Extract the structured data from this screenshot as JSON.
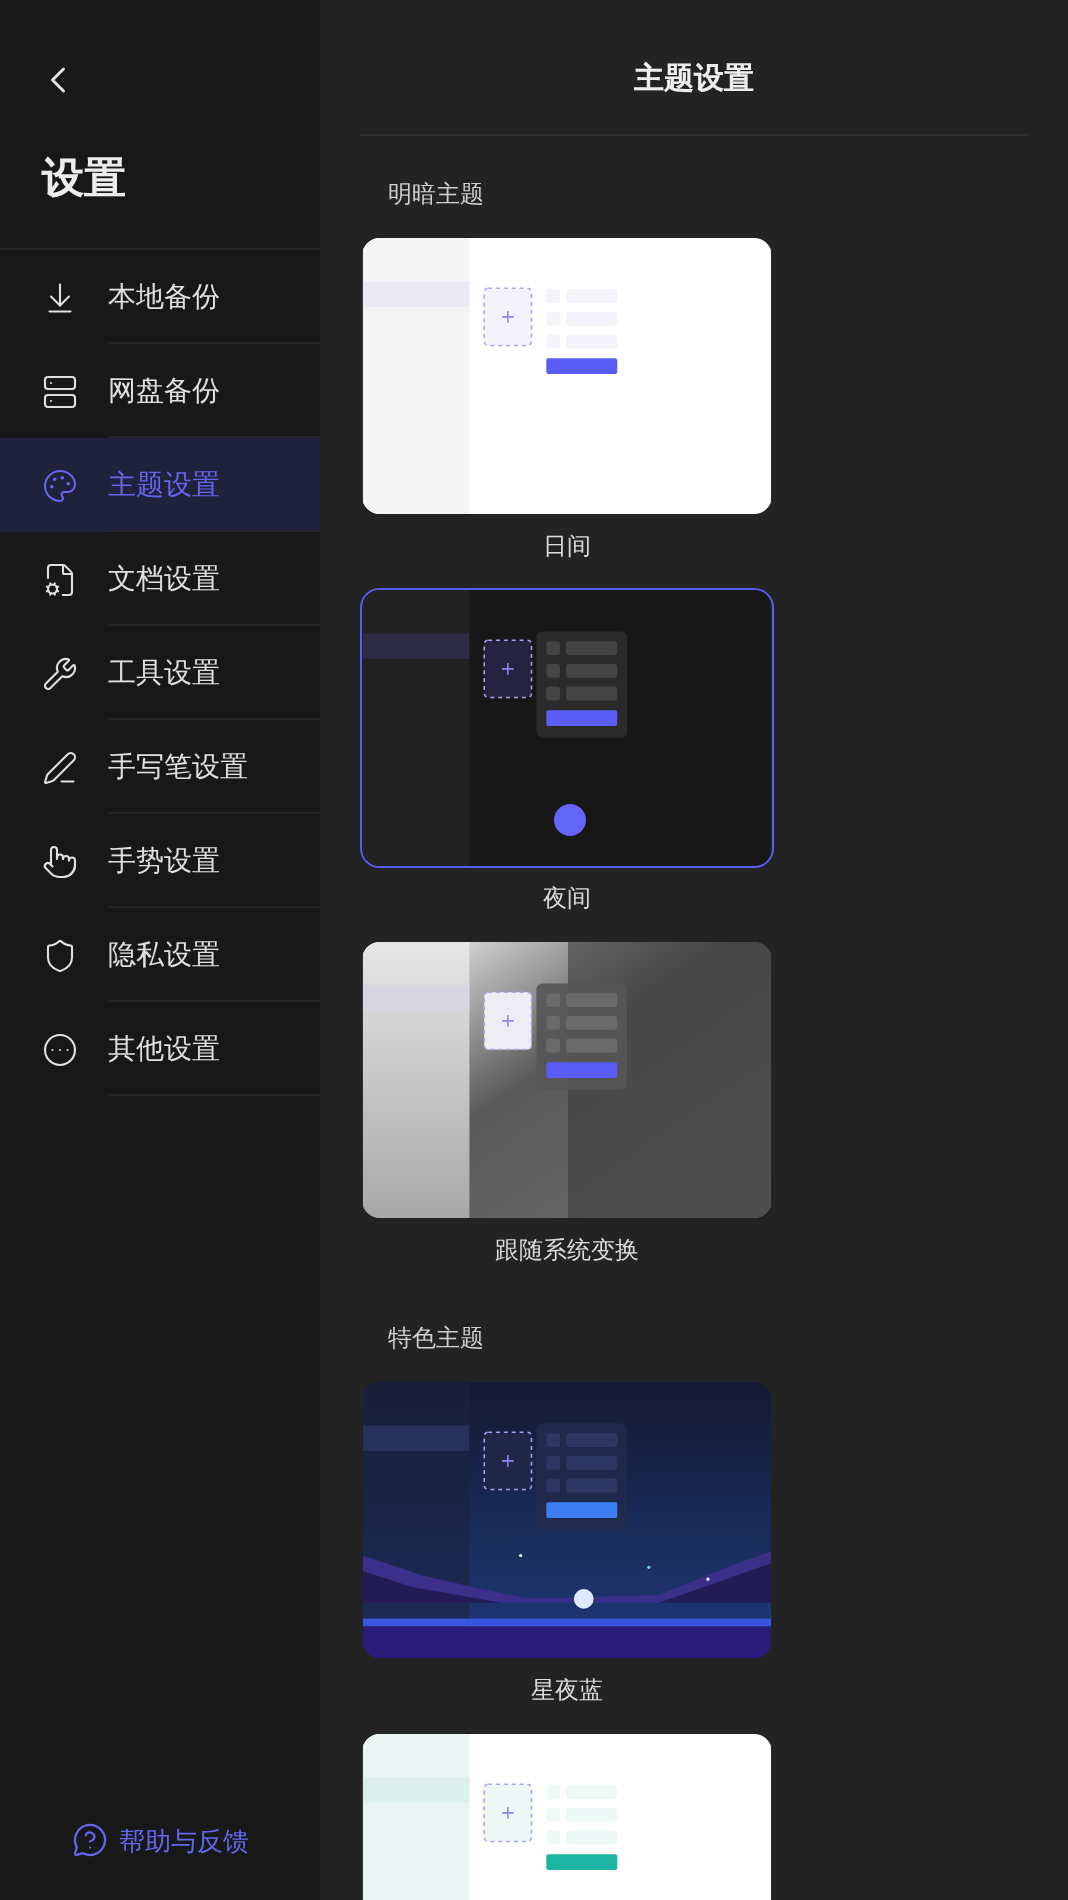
{
  "sidebar": {
    "title": "设置",
    "items": [
      {
        "label": "本地备份",
        "selected": false
      },
      {
        "label": "网盘备份",
        "selected": false
      },
      {
        "label": "主题设置",
        "selected": true
      },
      {
        "label": "文档设置",
        "selected": false
      },
      {
        "label": "工具设置",
        "selected": false
      },
      {
        "label": "手写笔设置",
        "selected": false
      },
      {
        "label": "手势设置",
        "selected": false
      },
      {
        "label": "隐私设置",
        "selected": false
      },
      {
        "label": "其他设置",
        "selected": false
      }
    ],
    "help": "帮助与反馈"
  },
  "header": {
    "title": "主题设置"
  },
  "sections": [
    {
      "title": "明暗主题",
      "themes": [
        {
          "kind": "light",
          "label": "日间",
          "selected": false
        },
        {
          "kind": "dark",
          "label": "夜间",
          "selected": true
        },
        {
          "kind": "auto",
          "label": "跟随系统变换",
          "selected": false
        }
      ]
    },
    {
      "title": "特色主题",
      "themes": [
        {
          "kind": "starry",
          "label": "星夜蓝",
          "selected": false
        },
        {
          "kind": "mint",
          "selected": false
        }
      ]
    }
  ]
}
